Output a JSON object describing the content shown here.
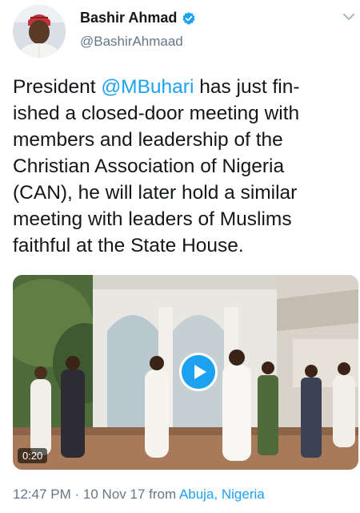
{
  "author": {
    "display_name": "Bashir Ahmad",
    "handle": "@BashirAhmaad",
    "verified": true
  },
  "tweet": {
    "segments": [
      {
        "type": "text",
        "text": "President "
      },
      {
        "type": "mention",
        "text": "@MBuhari"
      },
      {
        "type": "text",
        "text": " has just fin-\nished a closed-door meeting with\nmembers and leadership of the\nChristian Association of Nigeria\n(CAN), he will later hold a similar\nmeeting with leaders of Muslims\nfaithful at the State House."
      }
    ]
  },
  "media": {
    "duration": "0:20"
  },
  "meta": {
    "time": "12:47 PM",
    "separator": "·",
    "date": "10 Nov 17",
    "from_label": "from",
    "location": "Abuja, Nigeria"
  },
  "colors": {
    "accent": "#1da1f2",
    "text": "#14171a",
    "secondary": "#657786"
  },
  "icons": {
    "verified": "verified-badge-icon",
    "menu": "chevron-down-icon",
    "play": "play-icon"
  }
}
